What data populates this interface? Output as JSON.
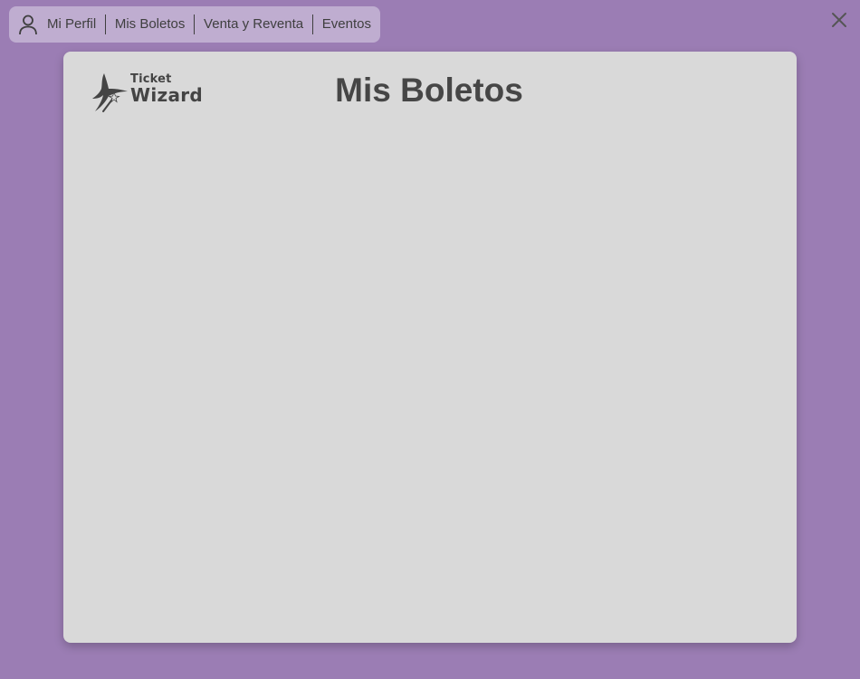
{
  "nav": {
    "items": [
      {
        "label": "Mi Perfil"
      },
      {
        "label": "Mis Boletos"
      },
      {
        "label": "Venta y Reventa"
      },
      {
        "label": "Eventos"
      }
    ]
  },
  "logo": {
    "line1": "Ticket",
    "line2": "Wizard"
  },
  "main": {
    "title": "Mis Boletos"
  },
  "icons": {
    "profile": "user-icon",
    "close": "close-icon",
    "logo": "wizard-logo-icon"
  },
  "colors": {
    "background": "#9b7db4",
    "navbar": "#bfadd0",
    "card": "#d9d9d9",
    "text": "#3f3f3f"
  }
}
